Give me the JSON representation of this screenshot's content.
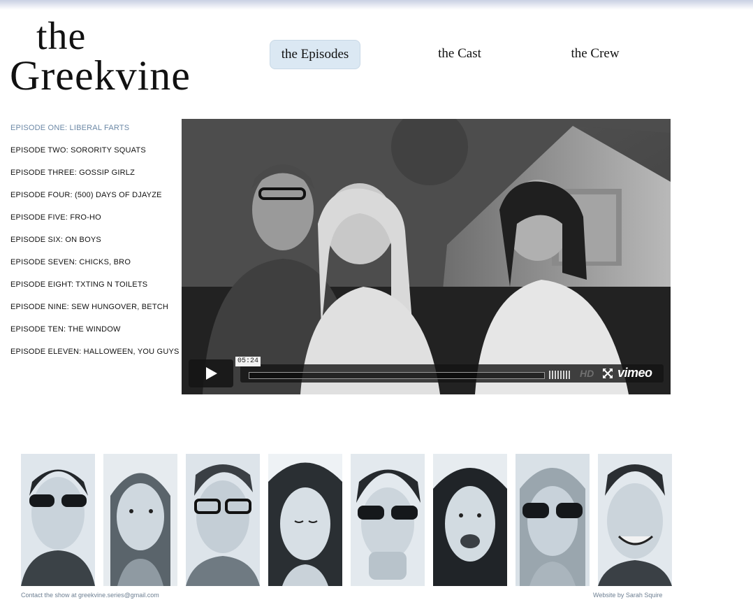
{
  "logo": {
    "line1": "the",
    "line2": "Greekvine"
  },
  "nav": {
    "episodes": "the Episodes",
    "cast": "the Cast",
    "crew": "the Crew",
    "active": "the Episodes"
  },
  "episodes": [
    "EPISODE ONE: LIBERAL FARTS",
    "EPISODE TWO: SORORITY SQUATS",
    "EPISODE THREE: GOSSIP GIRLZ",
    "EPISODE FOUR: (500) DAYS OF DJAYZE",
    "EPISODE FIVE: FRO-HO",
    "EPISODE SIX: ON BOYS",
    "EPISODE SEVEN: CHICKS, BRO",
    "EPISODE EIGHT: TXTING N TOILETS",
    "EPISODE NINE: SEW HUNGOVER, BETCH",
    "EPISODE TEN: THE WINDOW",
    "EPISODE ELEVEN: HALLOWEEN, YOU GUYS"
  ],
  "current_episode": "EPISODE ONE: LIBERAL FARTS",
  "player": {
    "duration": "05:24",
    "hd_label": "HD",
    "brand": "vimeo",
    "icons": [
      "play-icon",
      "volume-icon",
      "fullscreen-icon"
    ]
  },
  "cast_photos": [
    "cast-member-1",
    "cast-member-2",
    "cast-member-3",
    "cast-member-4",
    "cast-member-5",
    "cast-member-6",
    "cast-member-7",
    "cast-member-8"
  ],
  "footer": {
    "contact": "Contact the show at greekvine.series@gmail.com",
    "credit": "Website by Sarah Squire"
  },
  "colors": {
    "accent_tab": "#dbe8f3",
    "current_episode": "#6c88a6",
    "footer_text": "#6d7f92"
  }
}
